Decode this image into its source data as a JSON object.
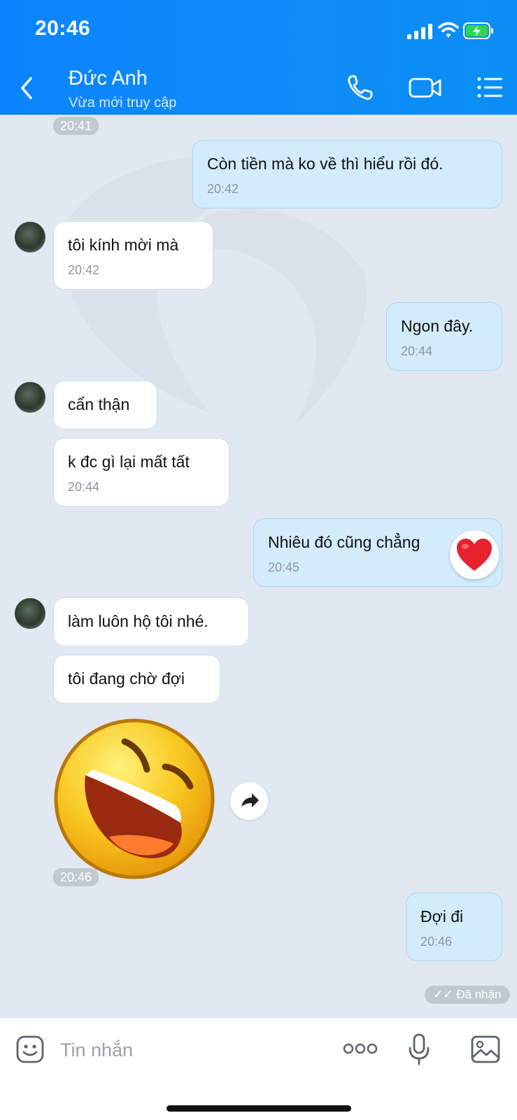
{
  "status_bar": {
    "time": "20:46"
  },
  "header": {
    "contact_name": "Đức Anh",
    "contact_status": "Vừa mới truy cập"
  },
  "messages": [
    {
      "type": "time",
      "text": "20:41"
    },
    {
      "type": "out",
      "text": "Còn tiền mà ko về thì hiểu rồi đó.",
      "time": "20:42"
    },
    {
      "type": "in",
      "text": "tôi kính mời mà",
      "time": "20:42"
    },
    {
      "type": "out",
      "text": "Ngon đây.",
      "time": "20:44"
    },
    {
      "type": "in",
      "text": "cẩn thận"
    },
    {
      "type": "in",
      "text": "k đc gì lại mất tất",
      "time": "20:44"
    },
    {
      "type": "out",
      "text": "Nhiêu đó cũng chẳng",
      "time": "20:45",
      "reaction": "heart"
    },
    {
      "type": "in",
      "text": "làm luôn hộ tôi nhé."
    },
    {
      "type": "in",
      "text": "tôi đang chờ đợi"
    },
    {
      "type": "sticker",
      "name": "laughing-face-sticker"
    },
    {
      "type": "time",
      "text": "20:46"
    },
    {
      "type": "out",
      "text": "Đợi đi",
      "time": "20:46"
    }
  ],
  "delivery_status": "Đã nhận",
  "composer": {
    "placeholder": "Tin nhắn"
  },
  "colors": {
    "header": "#0a84ff",
    "chat_bg": "#e2e8f1",
    "outgoing_bubble": "#d3ecfc",
    "incoming_bubble": "#ffffff"
  },
  "icons": [
    "back-icon",
    "phone-icon",
    "video-call-icon",
    "menu-list-icon",
    "emoji-icon",
    "more-dots-icon",
    "microphone-icon",
    "image-icon",
    "share-icon",
    "heart-reaction-icon"
  ]
}
